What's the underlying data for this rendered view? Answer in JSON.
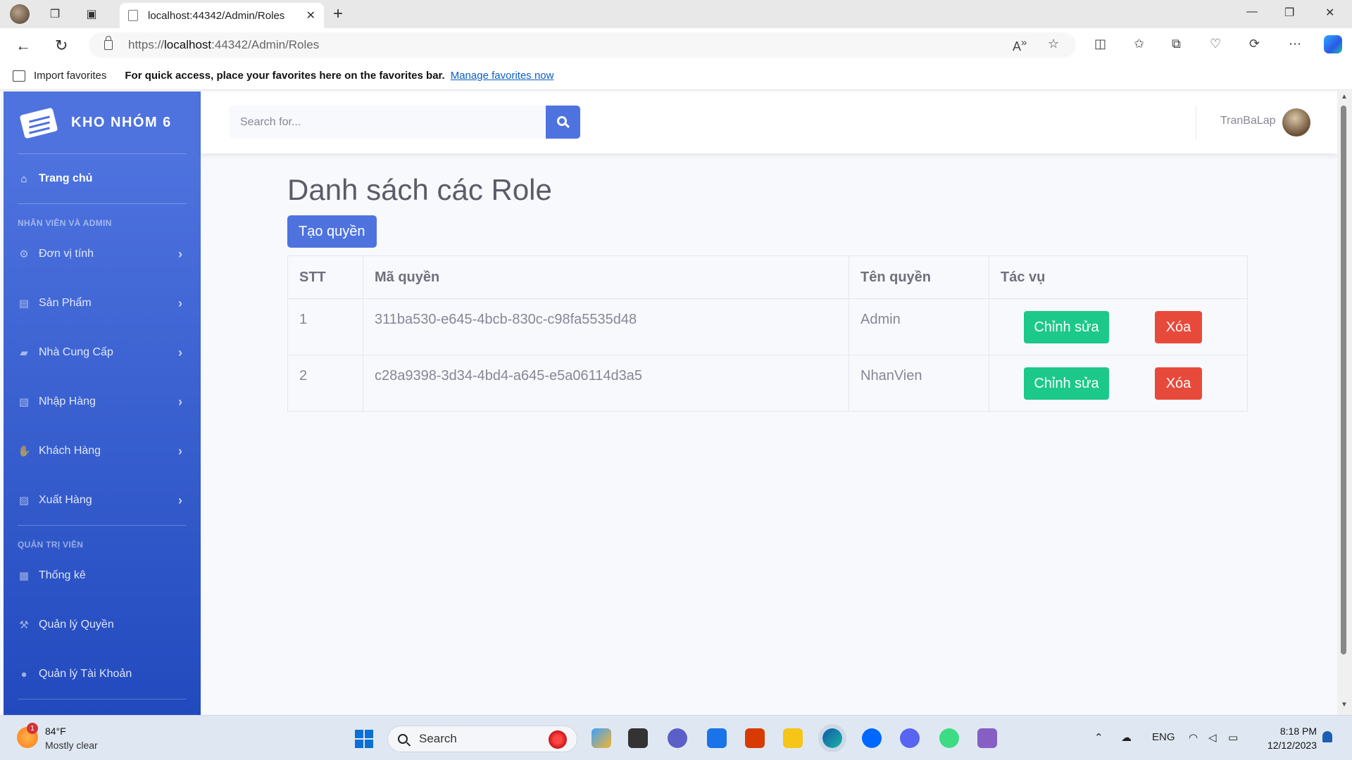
{
  "browser": {
    "tab_title": "localhost:44342/Admin/Roles",
    "url_scheme": "https://",
    "url_host": "localhost",
    "url_rest": ":44342/Admin/Roles",
    "favorites": {
      "import_label": "Import favorites",
      "message": "For quick access, place your favorites here on the favorites bar.",
      "manage_link": "Manage favorites now"
    }
  },
  "sidebar": {
    "brand": "KHO NHÓM 6",
    "home": "Trang chủ",
    "heading_staff": "NHÂN VIÊN VÀ ADMIN",
    "items": [
      {
        "label": "Đơn vị tính",
        "icon": "gear-icon"
      },
      {
        "label": "Sản Phẩm",
        "icon": "dolly-icon"
      },
      {
        "label": "Nhà Cung Cấp",
        "icon": "truck-icon"
      },
      {
        "label": "Nhập Hàng",
        "icon": "file-import-icon"
      },
      {
        "label": "Khách Hàng",
        "icon": "handshake-icon"
      },
      {
        "label": "Xuất Hàng",
        "icon": "file-export-icon"
      }
    ],
    "heading_admin": "QUẢN TRỊ VIÊN",
    "admin_items": [
      {
        "label": "Thống kê",
        "icon": "calculator-icon"
      },
      {
        "label": "Quản lý Quyền",
        "icon": "gavel-icon"
      },
      {
        "label": "Quản lý Tài Khoản",
        "icon": "user-icon"
      }
    ]
  },
  "topbar": {
    "search_placeholder": "Search for...",
    "username": "TranBaLap"
  },
  "main": {
    "title": "Danh sách các Role",
    "create_button": "Tạo quyền",
    "columns": [
      "STT",
      "Mã quyền",
      "Tên quyền",
      "Tác vụ"
    ],
    "rows": [
      {
        "stt": "1",
        "id": "311ba530-e645-4bcb-830c-c98fa5535d48",
        "name": "Admin"
      },
      {
        "stt": "2",
        "id": "c28a9398-3d34-4bd4-a645-e5a06114d3a5",
        "name": "NhanVien"
      }
    ],
    "edit_label": "Chỉnh sửa",
    "delete_label": "Xóa"
  },
  "taskbar": {
    "weather_temp": "84°F",
    "weather_desc": "Mostly clear",
    "weather_badge": "1",
    "search_label": "Search",
    "language": "ENG",
    "time": "8:18 PM",
    "date": "12/12/2023"
  },
  "colors": {
    "primary": "#4e73df",
    "success": "#1cc88a",
    "danger": "#e74a3b"
  }
}
